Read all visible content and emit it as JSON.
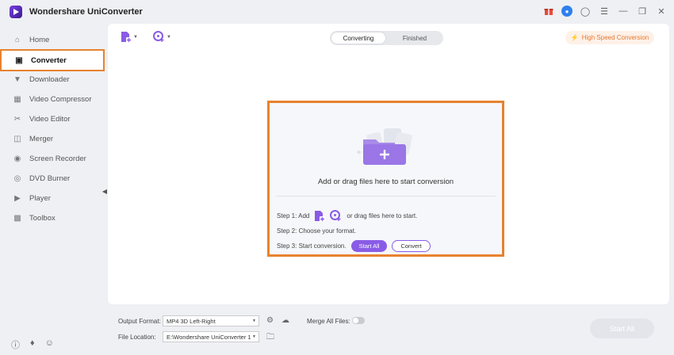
{
  "app": {
    "title": "Wondershare UniConverter"
  },
  "sidebar": {
    "items": [
      {
        "label": "Home",
        "icon": "home-icon"
      },
      {
        "label": "Converter",
        "icon": "converter-icon"
      },
      {
        "label": "Downloader",
        "icon": "download-icon"
      },
      {
        "label": "Video Compressor",
        "icon": "compress-icon"
      },
      {
        "label": "Video Editor",
        "icon": "scissors-icon"
      },
      {
        "label": "Merger",
        "icon": "merge-icon"
      },
      {
        "label": "Screen Recorder",
        "icon": "record-icon"
      },
      {
        "label": "DVD Burner",
        "icon": "disc-icon"
      },
      {
        "label": "Player",
        "icon": "play-icon"
      },
      {
        "label": "Toolbox",
        "icon": "grid-icon"
      }
    ]
  },
  "tabs": {
    "converting": "Converting",
    "finished": "Finished"
  },
  "high_speed": {
    "label": "High Speed Conversion"
  },
  "dropzone": {
    "title": "Add or drag files here to start conversion",
    "step1_prefix": "Step 1: Add",
    "step1_suffix": "or drag files here to start.",
    "step2": "Step 2: Choose your format.",
    "step3": "Step 3: Start conversion.",
    "start_all": "Start All",
    "convert": "Convert"
  },
  "bottom": {
    "output_format_label": "Output Format:",
    "output_format_value": "MP4 3D Left-Right",
    "merge_label": "Merge All Files:",
    "file_location_label": "File Location:",
    "file_location_value": "E:\\Wondershare UniConverter 1",
    "start_all": "Start All"
  },
  "colors": {
    "accent": "#8a5ce6",
    "highlight": "#e8822e"
  }
}
